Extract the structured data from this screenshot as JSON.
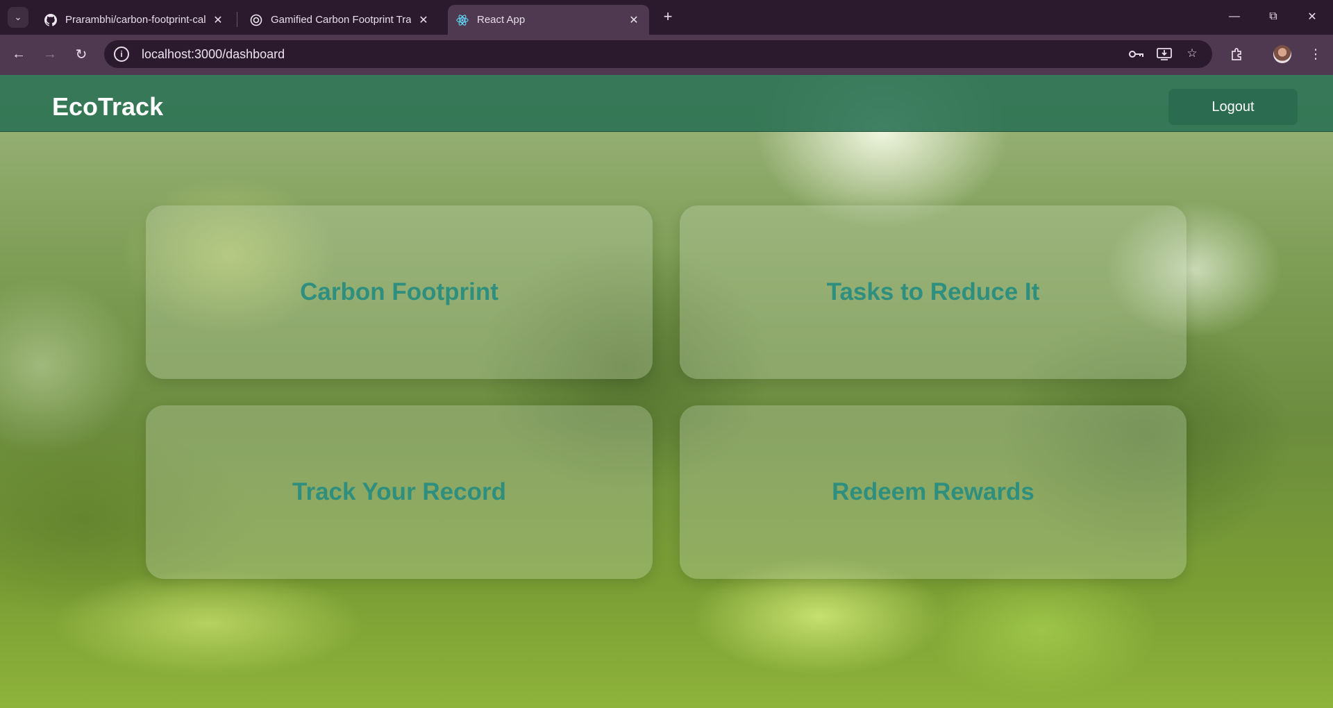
{
  "browser": {
    "tabs": [
      {
        "title": "Prarambhi/carbon-footprint-cal",
        "favicon": "github-icon",
        "active": false
      },
      {
        "title": "Gamified Carbon Footprint Trac",
        "favicon": "openai-icon",
        "active": false
      },
      {
        "title": "React App",
        "favicon": "react-icon",
        "active": true
      }
    ],
    "new_tab_label": "+",
    "url": "localhost:3000/dashboard"
  },
  "app": {
    "brand": "EcoTrack",
    "logout_label": "Logout",
    "cards": [
      {
        "label": "Carbon Footprint"
      },
      {
        "label": "Tasks to Reduce It"
      },
      {
        "label": "Track Your Record"
      },
      {
        "label": "Redeem Rewards"
      }
    ]
  },
  "colors": {
    "navbar": "#287052",
    "card_text": "#2f8f7e",
    "logout_bg": "#2b6b50"
  }
}
